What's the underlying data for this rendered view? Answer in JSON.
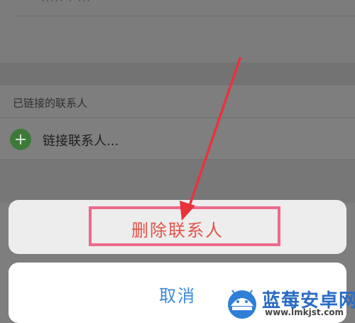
{
  "contact": {
    "top_partial_text": "····· · ···"
  },
  "linked_section": {
    "header": "已链接的联系人",
    "link_row_label": "链接联系人..."
  },
  "action_sheet": {
    "delete_label": "删除联系人",
    "cancel_label": "取消"
  },
  "annotation": {
    "highlight_color": "#ec6a8c",
    "arrow_color": "#e8333b"
  },
  "watermark": {
    "title": "蓝莓安卓网",
    "url": "www.lmkjst.com"
  },
  "colors": {
    "delete_red": "#e35349",
    "cancel_blue": "#3c8ad9",
    "plus_green": "#3d7a3a"
  }
}
